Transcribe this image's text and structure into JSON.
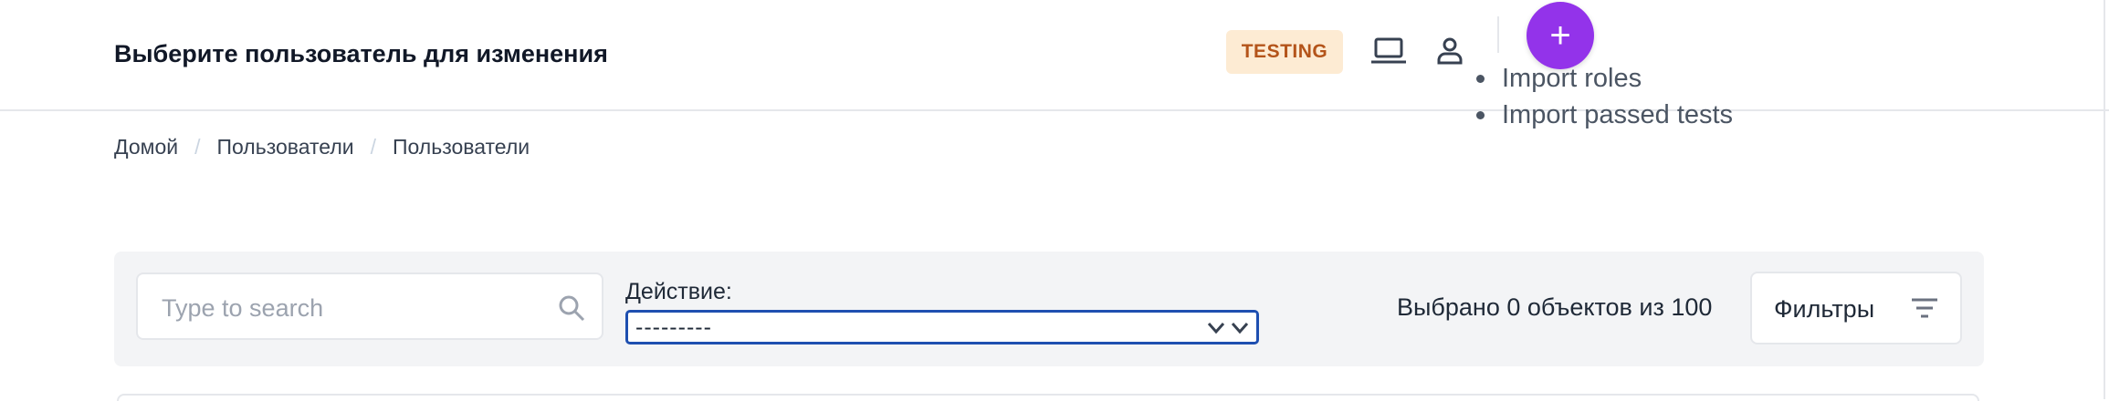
{
  "header": {
    "title": "Выберите пользователь для изменения",
    "env_badge": "TESTING",
    "add_button": "+",
    "icons": [
      "laptop-icon",
      "user-icon"
    ]
  },
  "menu": {
    "items": [
      "Import roles",
      "Import passed tests"
    ]
  },
  "breadcrumb": {
    "items": [
      "Домой",
      "Пользователи",
      "Пользователи"
    ],
    "separator": "/"
  },
  "toolbar": {
    "search_placeholder": "Type to search",
    "action_label": "Действие:",
    "action_value": "---------",
    "selected_count": "Выбрано 0 объектов из 100",
    "filter_label": "Фильтры"
  },
  "colors": {
    "accent": "#9333ea",
    "badge_bg": "#fdebd3",
    "badge_text": "#b4541a",
    "select_border": "#1e4fb0",
    "toolbar_bg": "#f3f4f6"
  }
}
